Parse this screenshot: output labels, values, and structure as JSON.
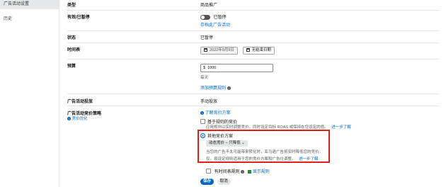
{
  "sidebar": {
    "items": [
      {
        "label": "广告活动设置"
      },
      {
        "label": "历史"
      }
    ]
  },
  "rows": {
    "type": {
      "label": "类型",
      "value": "商品推广"
    },
    "status_toggle": {
      "label": "有效/已暂停",
      "value": "已暂停",
      "link": "存档此广告活动"
    },
    "status": {
      "label": "状态",
      "value": "已暂停"
    },
    "period": {
      "label": "时间表",
      "start": "2022年9月9日",
      "end": "无结束日期"
    },
    "budget": {
      "label": "预算",
      "currency": "$",
      "amount": "1000",
      "period": "每天",
      "rules_link": "添加预算规则"
    },
    "targeting": {
      "label": "广告活动投放",
      "value": "手动投放"
    },
    "bidding": {
      "label": "广告活动竞价策略",
      "sublink": "竞价优化",
      "learn_link": "了解竞价方案",
      "option1_title": "基于规则的竞价",
      "option1_desc": "应用规则以实时调整竞价，同时设定目标 ROAS 或保持在您设定的值。",
      "option1_more": "进一步了解",
      "option2_title": "其他竞价方案",
      "dropdown_value": "动态竞价 – 只降低",
      "option2_desc_line1": "当您的广告不太可能带来转化时，亚马逊广告将实时降低您的竞价。",
      "option2_desc_line2": "仅，按设定规则适用于您的竞价方案和广告位调整。",
      "option2_more": "进一步了解",
      "schedule_label": "有时间表规则",
      "schedule_link": "显示规则"
    }
  },
  "actions": {
    "save": "保存",
    "cancel": "取消"
  },
  "colors": {
    "accent": "#0066c0",
    "highlight": "#e0201a",
    "save_bg": "#0066c0"
  }
}
